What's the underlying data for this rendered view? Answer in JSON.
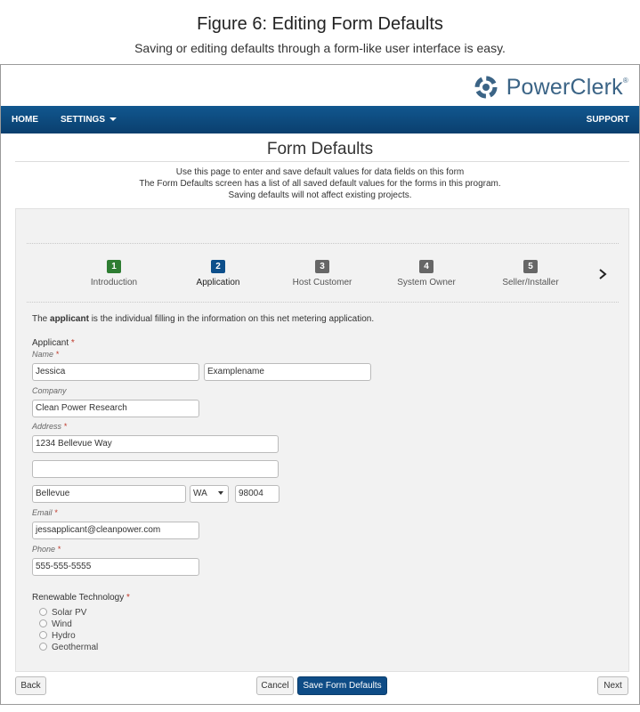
{
  "figure": {
    "title": "Figure 6: Editing Form Defaults",
    "subtitle": "Saving or editing defaults through a form-like user interface is easy."
  },
  "app": {
    "brand": "PowerClerk",
    "brand_mark": "®",
    "logo_icon": "powerclerk-logo-icon"
  },
  "nav": {
    "home": "HOME",
    "settings": "SETTINGS",
    "support": "SUPPORT"
  },
  "page": {
    "title": "Form Defaults",
    "intro": [
      "Use this page to enter and save default values for data fields on this form",
      "The Form Defaults screen has a list of all saved default values for the forms in this program.",
      "Saving defaults will not affect existing projects."
    ]
  },
  "steps": [
    {
      "num": "1",
      "label": "Introduction",
      "color": "#2e7d32"
    },
    {
      "num": "2",
      "label": "Application",
      "color": "#0d4f8b"
    },
    {
      "num": "3",
      "label": "Host Customer",
      "color": "#666666"
    },
    {
      "num": "4",
      "label": "System Owner",
      "color": "#666666"
    },
    {
      "num": "5",
      "label": "Seller/Installer",
      "color": "#666666"
    }
  ],
  "form": {
    "description_pre": "The ",
    "description_bold": "applicant",
    "description_post": " is the individual filling in the information on this net metering application.",
    "section_label": "Applicant",
    "name_label": "Name",
    "first_name": "Jessica",
    "last_name": "Examplename",
    "company_label": "Company",
    "company": "Clean Power Research",
    "address_label": "Address",
    "address_line1": "1234 Bellevue Way",
    "address_line2": "",
    "city": "Bellevue",
    "state": "WA",
    "zip": "98004",
    "email_label": "Email",
    "email": "jessapplicant@cleanpower.com",
    "phone_label": "Phone",
    "phone": "555-555-5555",
    "required_mark": "*",
    "tech_label": "Renewable Technology",
    "tech_options": [
      "Solar PV",
      "Wind",
      "Hydro",
      "Geothermal"
    ]
  },
  "buttons": {
    "back": "Back",
    "cancel": "Cancel",
    "save": "Save Form Defaults",
    "next": "Next"
  },
  "colors": {
    "nav": "#0b4a80",
    "primary_button": "#0e4c86",
    "required": "#c0392b"
  }
}
